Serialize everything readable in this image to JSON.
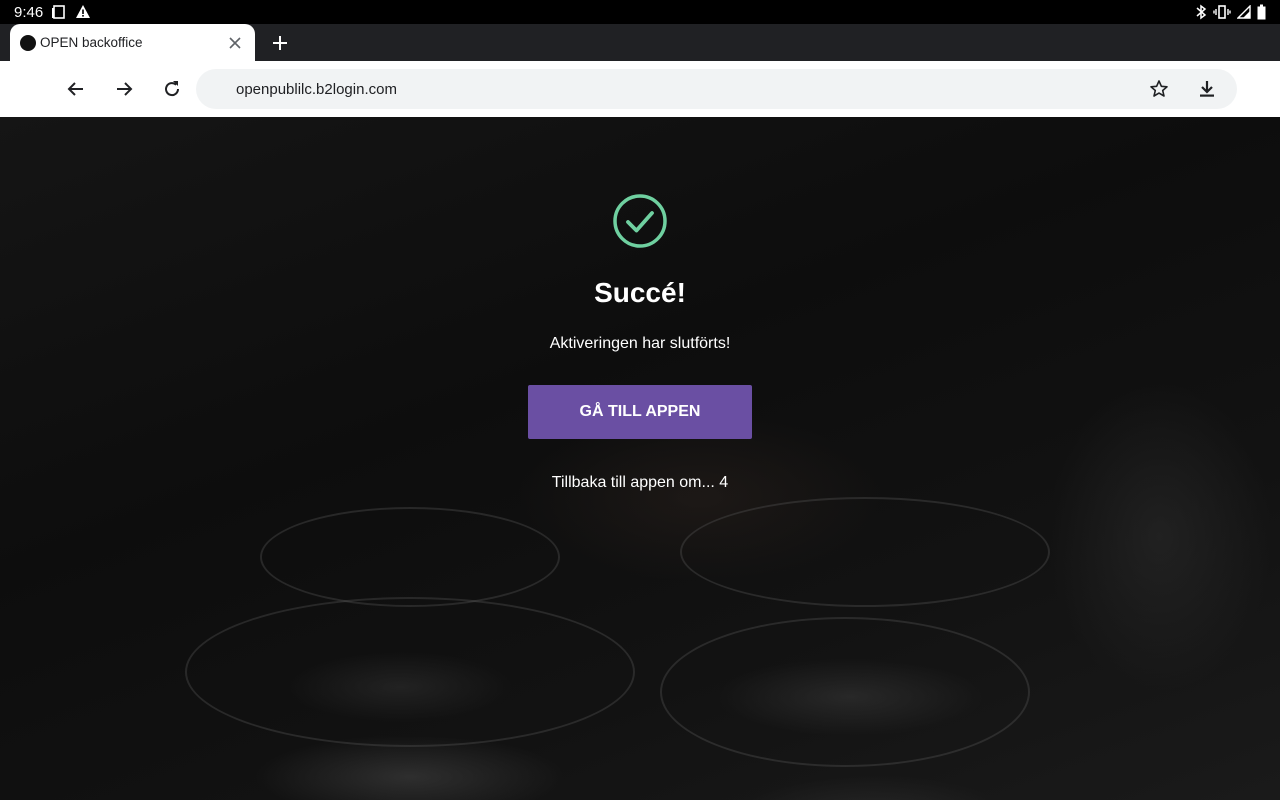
{
  "status_bar": {
    "time": "9:46",
    "left_icons": [
      "screenshot-icon",
      "warning-icon"
    ],
    "right_icons": [
      "bluetooth-icon",
      "vibrate-icon",
      "signal-icon",
      "battery-icon"
    ]
  },
  "browser": {
    "tab": {
      "title": "OPEN backoffice",
      "favicon": "circle-favicon-icon"
    },
    "omnibox": {
      "url": "openpublilc.b2login.com"
    }
  },
  "page": {
    "title": "Succé!",
    "message": "Aktiveringen har slutförts!",
    "button_label": "GÅ TILL APPEN",
    "countdown_text": "Tillbaka till appen om... 4"
  },
  "colors": {
    "accent_button": "#6a4fa3",
    "check_green": "#6fd0a0"
  }
}
